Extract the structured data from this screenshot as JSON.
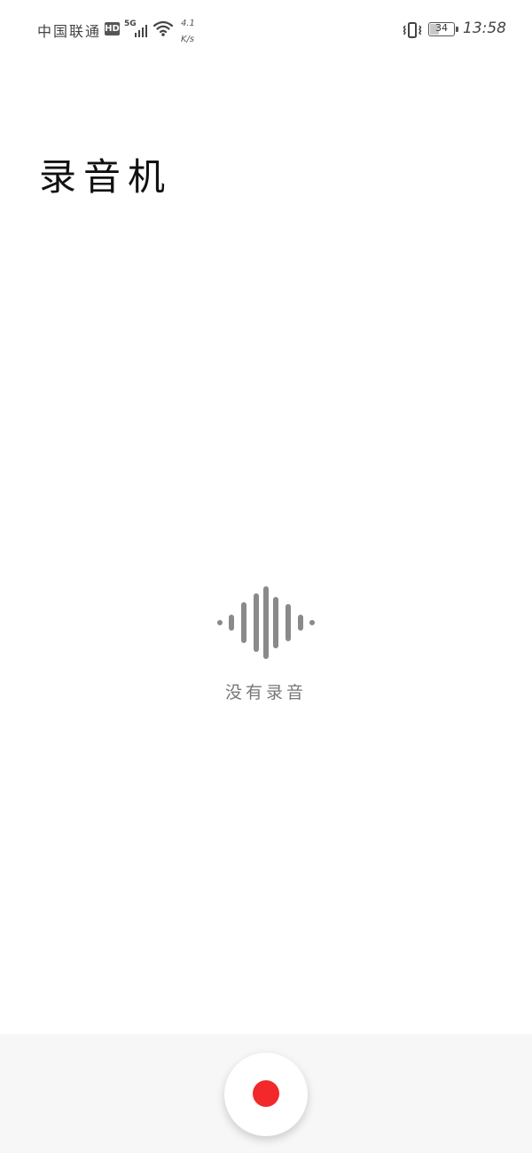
{
  "status_bar": {
    "carrier": "中国联通",
    "hd_badge": "HD",
    "network": "5G",
    "speed_value": "4.1",
    "speed_unit": "K/s",
    "battery_level": "34",
    "time": "13:58",
    "icons": [
      "hd-icon",
      "signal-icon",
      "wifi-icon",
      "vibrate-icon",
      "battery-icon"
    ]
  },
  "page": {
    "title": "录音机"
  },
  "empty_state": {
    "icon": "waveform-icon",
    "message": "没有录音"
  },
  "record_button": {
    "icon": "record-dot-icon"
  },
  "colors": {
    "record_red": "#f2282b",
    "waveform_gray": "#8a8a8a",
    "bottom_bar_bg": "#f7f7f7"
  }
}
